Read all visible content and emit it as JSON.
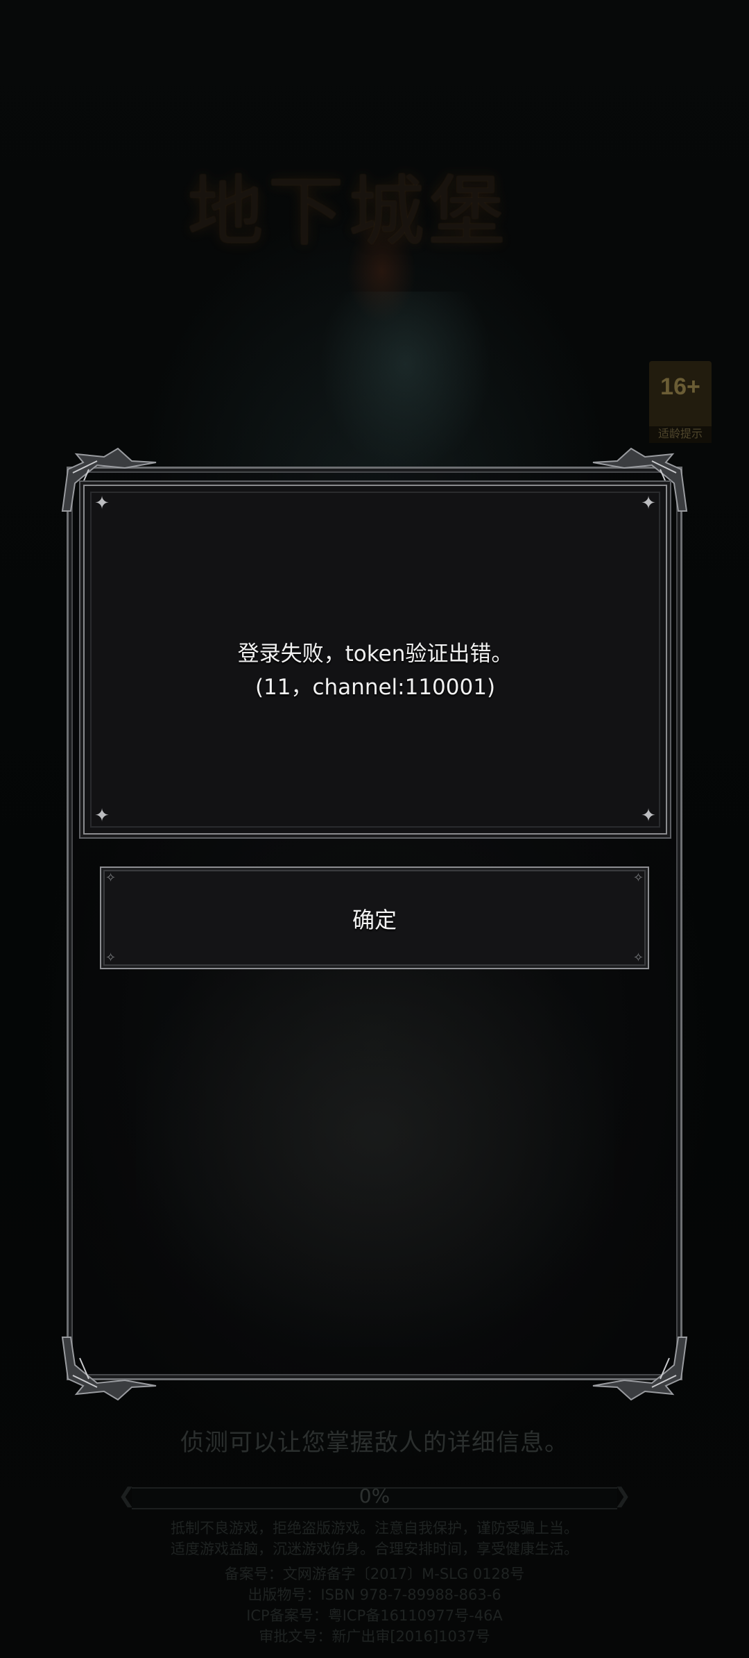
{
  "game": {
    "logo_text": "地下城堡",
    "age_rating": {
      "number": "16+",
      "label": "适龄提示"
    }
  },
  "dialog": {
    "message_line1": "登录失败，token验证出错。",
    "message_line2": "(11，channel:110001)",
    "confirm_label": "确定"
  },
  "loading": {
    "hint": "侦测可以让您掌握敌人的详细信息。",
    "progress_text": "0%",
    "progress_fraction": 0
  },
  "legal": {
    "health_line1": "抵制不良游戏，拒绝盗版游戏。注意自我保护，谨防受骗上当。",
    "health_line2": "适度游戏益脑，沉迷游戏伤身。合理安排时间，享受健康生活。",
    "record_no": "备案号：文网游备字〔2017〕M-SLG 0128号",
    "publication_no": "出版物号：ISBN 978-7-89988-863-6",
    "icp_no": "ICP备案号：粤ICP备16110977号-46A",
    "approval_no": "审批文号：新广出审[2016]1037号"
  },
  "colors": {
    "panel_bg": "#121214",
    "frame": "#8b8c8f",
    "text": "#f2f2f2"
  }
}
